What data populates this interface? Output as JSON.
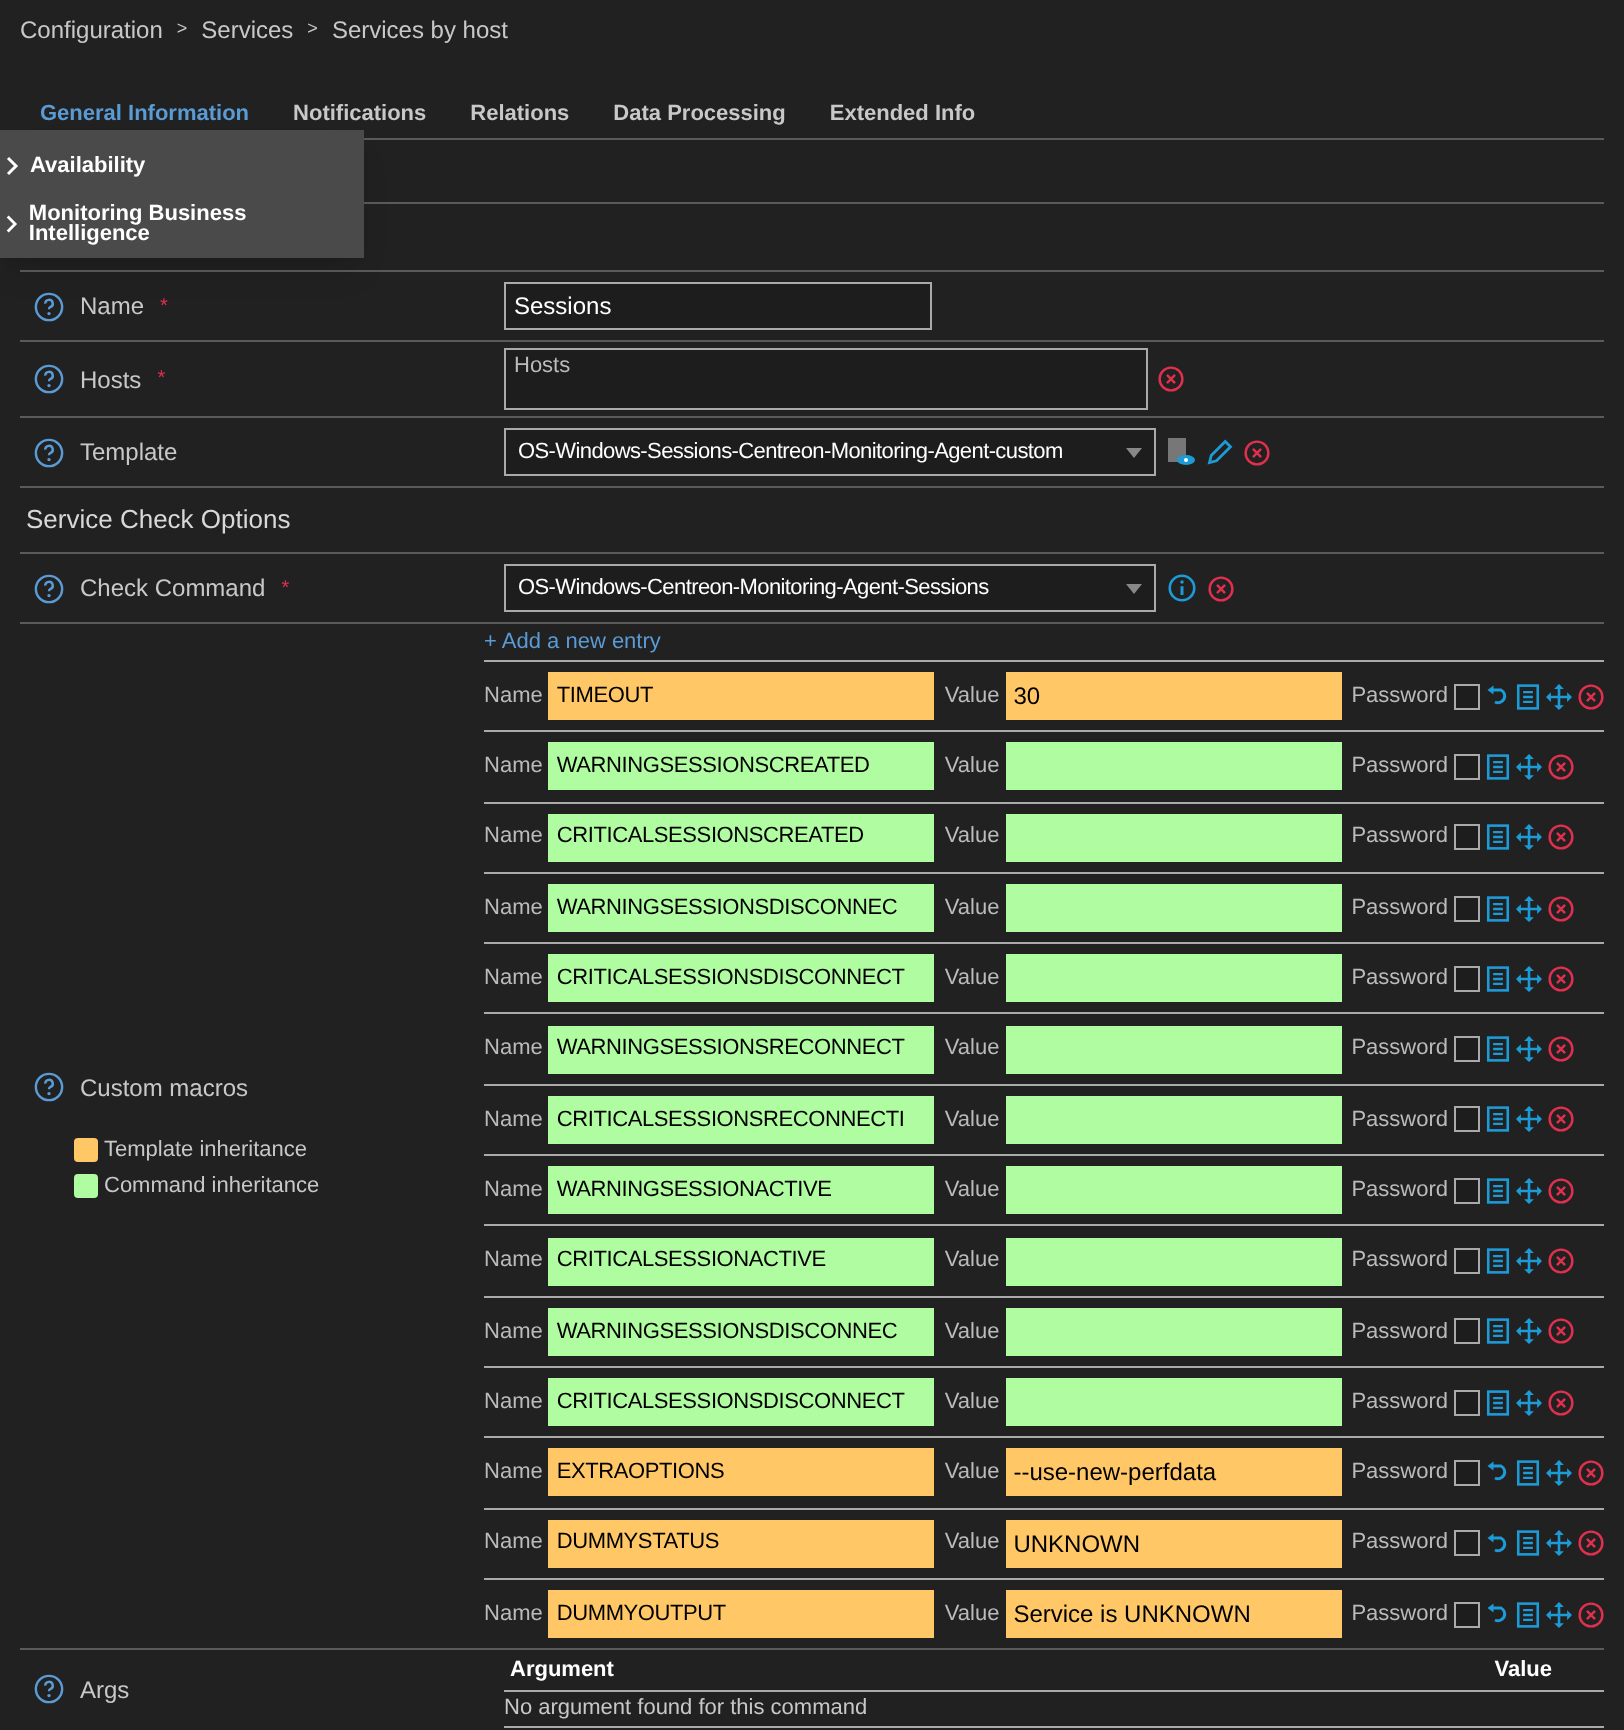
{
  "breadcrumb": [
    {
      "kind": "link",
      "text": "Configuration"
    },
    {
      "kind": "separator",
      "text": ">"
    },
    {
      "kind": "link",
      "text": "Services"
    },
    {
      "kind": "separator",
      "text": ">"
    },
    {
      "kind": "link",
      "text": "Services by host"
    }
  ],
  "tabs": [
    {
      "label": "General Information",
      "selected": true
    },
    {
      "label": "Notifications",
      "selected": false
    },
    {
      "label": "Relations",
      "selected": false
    },
    {
      "label": "Data Processing",
      "selected": false
    },
    {
      "label": "Extended Info",
      "selected": false
    }
  ],
  "menu": [
    {
      "label": "Availability"
    },
    {
      "label": "Monitoring Business Intelligence"
    }
  ],
  "fields": [
    {
      "kind": "text",
      "label": "Name",
      "required_mark": "*",
      "value": "Sessions"
    },
    {
      "kind": "textarea",
      "label": "Hosts",
      "required_mark": "*",
      "placeholder": "Hosts"
    },
    {
      "kind": "template",
      "label": "Template",
      "value": "OS-Windows-Sessions-Centreon-Monitoring-Agent-custom"
    }
  ],
  "section_title": "Service Check Options",
  "check_command": {
    "label": "Check Command",
    "required_mark": "*",
    "value": "OS-Windows-Centreon-Monitoring-Agent-Sessions"
  },
  "macros": {
    "label": "Custom macros",
    "add_link": "+ Add a new entry",
    "legend": [
      {
        "label": "Template inheritance",
        "color": "#ffc766"
      },
      {
        "label": "Command inheritance",
        "color": "#b0fca0"
      }
    ],
    "rows": [
      {
        "kind": "template",
        "name_label": "Name",
        "name": "TIMEOUT",
        "value_label": "Value",
        "value": "30",
        "password_label": "Password",
        "password": false
      },
      {
        "kind": "command",
        "name_label": "Name",
        "name": "WARNINGSESSIONSCREATED",
        "value_label": "Value",
        "password_label": "Password",
        "password": false
      },
      {
        "kind": "command",
        "name_label": "Name",
        "name": "CRITICALSESSIONSCREATED",
        "value_label": "Value",
        "password_label": "Password",
        "password": false
      },
      {
        "kind": "command",
        "name_label": "Name",
        "name": "WARNINGSESSIONSDISCONNEC",
        "value_label": "Value",
        "password_label": "Password",
        "password": false
      },
      {
        "kind": "command",
        "name_label": "Name",
        "name": "CRITICALSESSIONSDISCONNECT",
        "value_label": "Value",
        "password_label": "Password",
        "password": false
      },
      {
        "kind": "command",
        "name_label": "Name",
        "name": "WARNINGSESSIONSRECONNECT",
        "value_label": "Value",
        "password_label": "Password",
        "password": false
      },
      {
        "kind": "command",
        "name_label": "Name",
        "name": "CRITICALSESSIONSRECONNECTI",
        "value_label": "Value",
        "password_label": "Password",
        "password": false
      },
      {
        "kind": "command",
        "name_label": "Name",
        "name": "WARNINGSESSIONACTIVE",
        "value_label": "Value",
        "password_label": "Password",
        "password": false
      },
      {
        "kind": "command",
        "name_label": "Name",
        "name": "CRITICALSESSIONACTIVE",
        "value_label": "Value",
        "password_label": "Password",
        "password": false
      },
      {
        "kind": "command",
        "name_label": "Name",
        "name": "WARNINGSESSIONSDISCONNEC",
        "value_label": "Value",
        "password_label": "Password",
        "password": false
      },
      {
        "kind": "command",
        "name_label": "Name",
        "name": "CRITICALSESSIONSDISCONNECT",
        "value_label": "Value",
        "password_label": "Password",
        "password": false
      },
      {
        "kind": "template",
        "name_label": "Name",
        "name": "EXTRAOPTIONS",
        "value_label": "Value",
        "value": "--use-new-perfdata",
        "password_label": "Password",
        "password": false
      },
      {
        "kind": "template",
        "name_label": "Name",
        "name": "DUMMYSTATUS",
        "value_label": "Value",
        "value": "UNKNOWN",
        "password_label": "Password",
        "password": false
      },
      {
        "kind": "template",
        "name_label": "Name",
        "name": "DUMMYOUTPUT",
        "value_label": "Value",
        "value": "Service is UNKNOWN",
        "password_label": "Password",
        "password": false
      }
    ]
  },
  "args": {
    "label": "Args",
    "columns": [
      "Argument",
      "Value"
    ],
    "empty_text": "No argument found for this command"
  }
}
